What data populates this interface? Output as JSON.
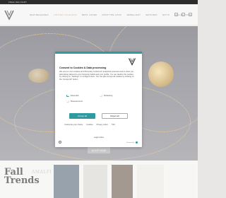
{
  "topbar": {
    "promo": "FREE DELIVERY",
    "right": ""
  },
  "nav": {
    "items": [
      "NEW RELEASES",
      "LIMITED CALENDAR",
      "BEST LOVED",
      "SHOP THE LOOK",
      "JEWELLERY",
      "WATCHES",
      "GIFTS",
      "COLLECTIONS"
    ],
    "active_index": 1
  },
  "hero": {
    "cta": "SHOP NOW"
  },
  "strip": {
    "fall_line1": "Fall",
    "fall_line2": "Trends",
    "amalfi": "AMALFI"
  },
  "consent": {
    "title": "Consent to Cookies & Data processing",
    "body": "We use our own cookies and third-party cookies for analytical purposes and to show you advertising tailored to your browsing habits and your profile. You can decline the cookies by clicking on \"Settings\" or configure them. You can also accept all cookies by clicking on the \"Accept All\" button",
    "options": [
      {
        "label": "Essential",
        "on": true
      },
      {
        "label": "Marketing",
        "on": false
      },
      {
        "label": "Measurement",
        "on": false
      }
    ],
    "accept_label": "Accept all",
    "reject_label": "Reject all",
    "links_row1": [
      "Customise your choice",
      "Cookies",
      "Privacy notice",
      "T&C"
    ],
    "links_row2": [
      "Legal notice"
    ],
    "powered_by": "Powered by"
  },
  "colors": {
    "accent": "#2f9aa0",
    "nav_active": "#c8875a",
    "gold": "#d8b46a"
  }
}
